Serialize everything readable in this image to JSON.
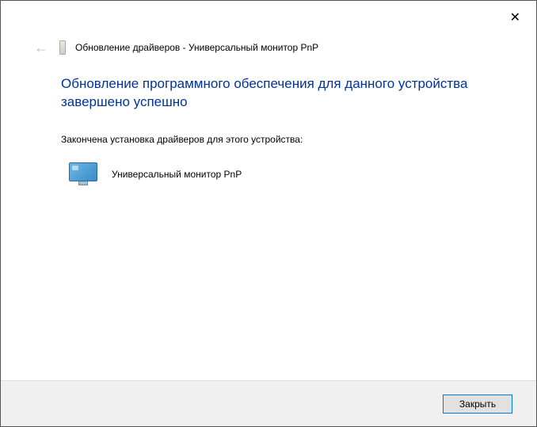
{
  "titlebar": {
    "close_label": "✕"
  },
  "header": {
    "back_glyph": "←",
    "title": "Обновление драйверов - Универсальный монитор PnP"
  },
  "content": {
    "heading": "Обновление программного обеспечения для данного устройства завершено успешно",
    "subtext": "Закончена установка драйверов для этого устройства:",
    "device_name": "Универсальный монитор PnP"
  },
  "footer": {
    "close_button_label": "Закрыть"
  }
}
